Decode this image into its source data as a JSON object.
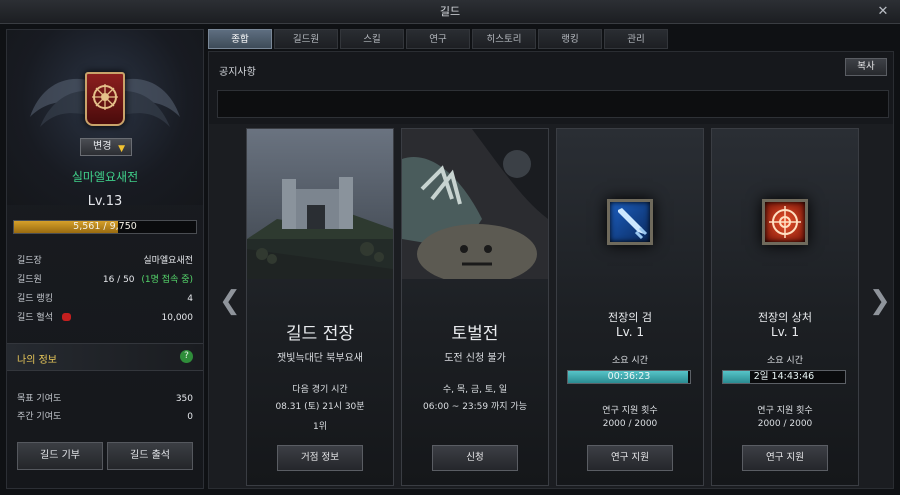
{
  "window": {
    "title": "길드",
    "close": "✕"
  },
  "left_panel": {
    "change_button": "변경",
    "guild_name": "실마엘요새전",
    "guild_level": "Lv.13",
    "exp": {
      "text": "5,561 / 9,750",
      "fraction": 0.57
    },
    "stats": {
      "leader_label": "길드장",
      "leader_value": "실마엘요새전",
      "members_label": "길드원",
      "members_value": "16 / 50",
      "members_online": "(1명 접속 중)",
      "rank_label": "길드 랭킹",
      "rank_value": "4",
      "blood_label": "길드 혈석",
      "blood_value": "10,000"
    },
    "my_info": {
      "title": "나의 정보",
      "help": "?",
      "target_label": "목표 기여도",
      "target_value": "350",
      "weekly_label": "주간 기여도",
      "weekly_value": "0"
    },
    "buttons": {
      "donate": "길드 기부",
      "attendance": "길드 출석"
    }
  },
  "tabs": [
    "종합",
    "길드원",
    "스킬",
    "연구",
    "히스토리",
    "랭킹",
    "관리"
  ],
  "notice": {
    "label": "공지사항",
    "copy_button": "복사"
  },
  "cards": {
    "battle": {
      "title": "길드 전장",
      "subtitle": "잿빛늑대단 북부요새",
      "next_label": "다음 경기 시간",
      "next_time": "08.31 (토) 21시 30분",
      "rank": "1위",
      "button": "거점 정보"
    },
    "raid": {
      "title": "토벌전",
      "subtitle": "도전 신청 불가",
      "days": "수, 목, 금, 토, 일",
      "hours": "06:00 ~ 23:59 까지 가능",
      "button": "신청"
    },
    "sword": {
      "title": "전장의 검",
      "level": "Lv. 1",
      "time_label": "소요 시간",
      "time_value": "00:36:23",
      "time_fill": 0.98,
      "support_label": "연구 지원 횟수",
      "support_value": "2000 / 2000",
      "button": "연구 지원"
    },
    "wound": {
      "title": "전장의 상처",
      "level": "Lv. 1",
      "time_label": "소요 시간",
      "time_value": "2일 14:43:46",
      "time_fill": 0.22,
      "support_label": "연구 지원 횟수",
      "support_value": "2000 / 2000",
      "button": "연구 지원"
    }
  },
  "nav": {
    "prev": "❮",
    "next": "❯"
  },
  "colors": {
    "accent_green": "#3fcf89",
    "gold": "#e7c431",
    "exp": "#c08a1c",
    "timer": "#3aa6ab"
  }
}
